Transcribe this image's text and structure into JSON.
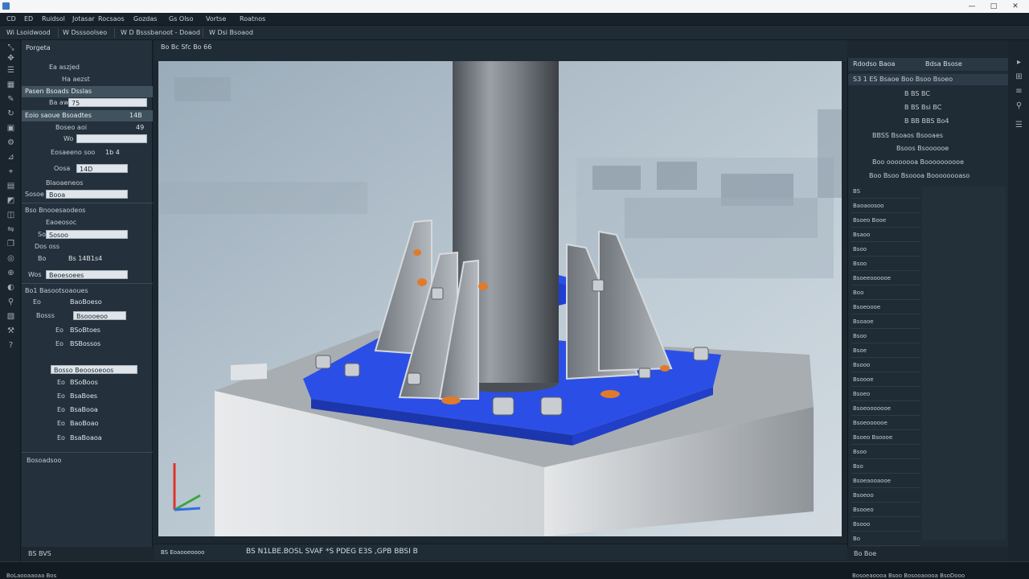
{
  "window": {
    "controls": [
      "—",
      "□",
      "✕"
    ]
  },
  "menu": [
    "CD",
    "ED",
    "Ruidsol",
    "Jotasar",
    "Rocsaos",
    "Gozdas",
    "Gs Olso",
    "Vortse",
    "Roatnos"
  ],
  "toolbar": [
    "Wi Lsoidwood",
    "W Dsssoolseo",
    "W D Bsssbanoot - Doaod",
    "W Dsi Bsoaod"
  ],
  "left_panel": {
    "title": "Porgeta",
    "rows": [
      {
        "label": "Ea  aszjed",
        "value": "",
        "kind": "text"
      },
      {
        "label": "Ha  aezst",
        "value": "",
        "kind": "text"
      },
      {
        "label": "Pasen Bsoads Dsslas",
        "value": "",
        "kind": "header"
      },
      {
        "label": "Ba  aw",
        "value": "75",
        "kind": "field"
      },
      {
        "label": "Eoio saoue Bsoadtes",
        "value": "14B",
        "kind": "header"
      },
      {
        "label": "Boseo aoi",
        "value": "49",
        "kind": "count"
      },
      {
        "label": "Wo",
        "value": "",
        "kind": "field"
      },
      {
        "label": "Eosaeeno  soo",
        "value": "1b 4",
        "kind": "text"
      },
      {
        "label": "Oosa",
        "value": "14D",
        "kind": "field"
      },
      {
        "label": "Blaoaeneos",
        "value": "",
        "kind": "text"
      },
      {
        "label": "Sosoe",
        "value": "Booa",
        "kind": "field"
      },
      {
        "label": "Bso  Bnooesaodeos",
        "value": "",
        "kind": "header"
      },
      {
        "label": "Eaoeosoc",
        "value": "",
        "kind": "text"
      },
      {
        "label": "Soo",
        "value": "Sosoo",
        "kind": "field"
      },
      {
        "label": "Dos  oss",
        "value": "",
        "kind": "text"
      },
      {
        "label": "Bo",
        "value": "Bs 14B1s4",
        "kind": "text"
      },
      {
        "label": "Wos",
        "value": "Beoesoees",
        "kind": "field"
      },
      {
        "label": "Bo1  Basootsoaoues",
        "value": "",
        "kind": "header"
      },
      {
        "label": "Eo",
        "value": "BaoBoeso",
        "kind": "text"
      },
      {
        "label": "Bosss",
        "value": "Bsoooeoo",
        "kind": "field"
      },
      {
        "label": "Eo",
        "value": "BSoBtoes",
        "kind": "text"
      },
      {
        "label": "Eo",
        "value": "BSBossos",
        "kind": "text"
      },
      {
        "label": "",
        "value": "Bosso  Beoosoeoos",
        "kind": "field"
      },
      {
        "label": "Eo",
        "value": "BSoBoos",
        "kind": "text"
      },
      {
        "label": "Eo",
        "value": "BsaBoes",
        "kind": "text"
      },
      {
        "label": "Eo",
        "value": "BsaBooa",
        "kind": "text"
      },
      {
        "label": "Eo",
        "value": "BaoBoao",
        "kind": "text"
      },
      {
        "label": "Eo",
        "value": "BsaBoaoa",
        "kind": "text"
      },
      {
        "label": "Bosoadsoo",
        "value": "",
        "kind": "text"
      }
    ]
  },
  "viewport": {
    "title": "Bo Bc  Sfc  Bo 66"
  },
  "right_panel": {
    "tabs": [
      "Rdodso Baoa",
      "Bdsa Bsose"
    ],
    "rows": [
      {
        "label": "S3  1 ES  Bsaoe  Boo  Bsoo  Bsoeo",
        "indent": 6
      },
      {
        "label": "B  BS  BC",
        "indent": 70
      },
      {
        "label": "B  BS  Bsi  BC",
        "indent": 70
      },
      {
        "label": "B  BB  BBS  Bo4",
        "indent": 70
      },
      {
        "label": "BBSS Bsoaos  Bsooaes",
        "indent": 30
      },
      {
        "label": "Bsoos  Bsoooooe",
        "indent": 60
      },
      {
        "label": "Boo oooooooa  Boooooooooe",
        "indent": 30
      },
      {
        "label": "Boo Bsoo  Bsoooa  Boooooooaso",
        "indent": 26
      }
    ],
    "list": [
      "BS",
      "Baoaoosoo",
      "Bsoeo Booe",
      "Bsaoo",
      "Bsoo",
      "Bsoo",
      "Bsoeeoooooe",
      "Boo",
      "Bsoeoooe",
      "Bsoaoe",
      "Bsoo",
      "Bsoe",
      "Bsooo",
      "Bsoooe",
      "Bsoeo",
      "Bsoeooooooe",
      "Bsoeoooooe",
      "Bsoeo Bsoooe",
      "Bsoo",
      "Bso",
      "Bsoeaooaooe",
      "Bsoeoo",
      "Bsooeo",
      "Bsooo",
      "Bo"
    ]
  },
  "command_bar": {
    "left_label": "BS  Eoaooeoooo",
    "command": "BS  N1LBE.BOSL  SVAF  *S PDEG  E3S  ,GPB  BBSI  B"
  },
  "status_bar": {
    "text": "BoLaooaaoaa  Bos",
    "icons_text": "BS  BVS",
    "right_text": "Bosoeaoooa  Bsoo  Bosooaoooa  BsoDooo",
    "far_right": "Bo  Boe"
  },
  "colors": {
    "accent_blue": "#2b4fe6",
    "steel": "#8b8f93",
    "concrete": "#c8ccd0",
    "ui_dark": "#1c2730"
  }
}
